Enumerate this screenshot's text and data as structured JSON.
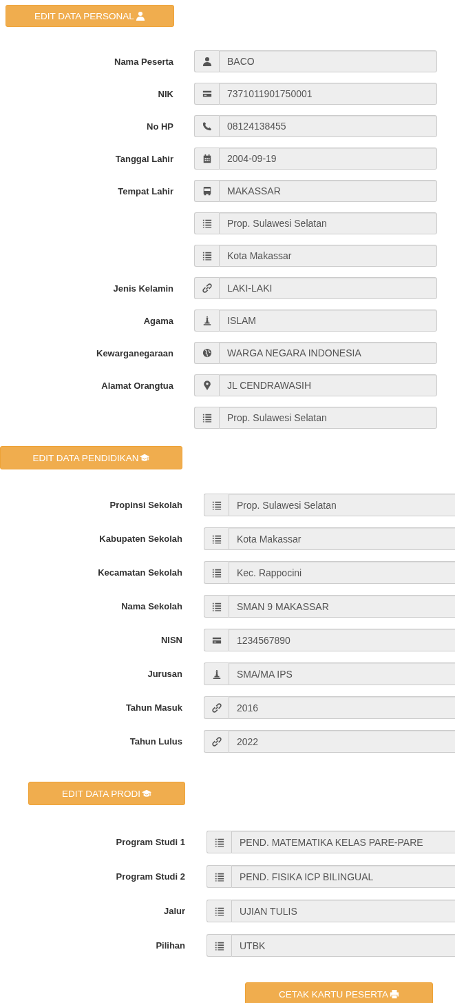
{
  "sections": [
    {
      "button": {
        "label": "EDIT DATA PERSONAL",
        "kind": "user"
      },
      "rows": [
        {
          "label": "Nama Peserta",
          "kind": "user",
          "value": "BACO"
        },
        {
          "label": "NIK",
          "kind": "card",
          "value": "7371011901750001"
        },
        {
          "label": "No HP",
          "kind": "phone",
          "value": "08124138455"
        },
        {
          "label": "Tanggal Lahir",
          "kind": "calendar",
          "value": "2004-09-19"
        },
        {
          "label": "Tempat Lahir",
          "kind": "bus",
          "value": "MAKASSAR"
        },
        {
          "kind": "list",
          "value": "Prop. Sulawesi Selatan"
        },
        {
          "kind": "list",
          "value": "Kota Makassar"
        },
        {
          "label": "Jenis Kelamin",
          "kind": "link",
          "value": "LAKI-LAKI"
        },
        {
          "label": "Agama",
          "kind": "pawn",
          "value": "ISLAM"
        },
        {
          "label": "Kewarganegaraan",
          "kind": "globe",
          "value": "WARGA NEGARA INDONESIA"
        },
        {
          "label": "Alamat Orangtua",
          "kind": "marker",
          "value": "JL CENDRAWASIH"
        },
        {
          "kind": "list",
          "value": "Prop. Sulawesi Selatan"
        }
      ]
    },
    {
      "button": {
        "label": "EDIT DATA PENDIDIKAN",
        "kind": "cap"
      },
      "rows": [
        {
          "label": "Propinsi Sekolah",
          "kind": "list",
          "value": "Prop. Sulawesi Selatan"
        },
        {
          "label": "Kabupaten Sekolah",
          "kind": "list",
          "value": "Kota Makassar"
        },
        {
          "label": "Kecamatan Sekolah",
          "kind": "list",
          "value": "Kec. Rappocini"
        },
        {
          "label": "Nama Sekolah",
          "kind": "list",
          "value": "SMAN 9 MAKASSAR"
        },
        {
          "label": "NISN",
          "kind": "card",
          "value": "1234567890"
        },
        {
          "label": "Jurusan",
          "kind": "pawn",
          "value": "SMA/MA IPS"
        },
        {
          "label": "Tahun Masuk",
          "kind": "link",
          "value": "2016"
        },
        {
          "label": "Tahun Lulus",
          "kind": "link",
          "value": "2022"
        }
      ]
    },
    {
      "button": {
        "label": "EDIT DATA PRODI",
        "kind": "cap"
      },
      "rows": [
        {
          "label": "Program Studi 1",
          "kind": "list",
          "value": "PEND. MATEMATIKA KELAS PARE-PARE"
        },
        {
          "label": "Program Studi 2",
          "kind": "list",
          "value": "PEND. FISIKA ICP BILINGUAL"
        },
        {
          "label": "Jalur",
          "kind": "list",
          "value": "UJIAN TULIS"
        },
        {
          "label": "Pilihan",
          "kind": "list",
          "value": "UTBK"
        }
      ]
    }
  ],
  "print_button": {
    "label": "CETAK KARTU PESERTA",
    "kind": "print"
  }
}
